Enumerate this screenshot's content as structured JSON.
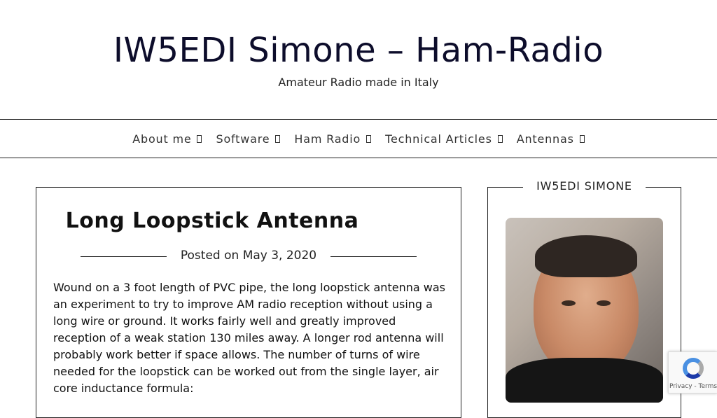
{
  "site": {
    "title": "IW5EDI Simone – Ham-Radio",
    "tagline": "Amateur Radio made in Italy"
  },
  "nav": {
    "items": [
      {
        "label": "About me"
      },
      {
        "label": "Software"
      },
      {
        "label": "Ham Radio"
      },
      {
        "label": "Technical Articles"
      },
      {
        "label": "Antennas"
      }
    ]
  },
  "post": {
    "title": "Long Loopstick Antenna",
    "posted_prefix": "Posted on",
    "date": "May 3, 2020",
    "body": "Wound on a 3 foot length of PVC pipe, the long loopstick antenna was an experiment to try to improve AM radio reception without using a long wire or ground. It works fairly well and greatly improved reception of a weak station 130 miles away. A longer rod antenna will probably work better if space allows. The number of turns of wire needed for the loopstick can be worked out from the single layer, air core inductance formula:"
  },
  "sidebar": {
    "widget_title": "IW5EDI Simone"
  },
  "recaptcha": {
    "privacy": "Privacy",
    "separator": " - ",
    "terms": "Terms"
  }
}
